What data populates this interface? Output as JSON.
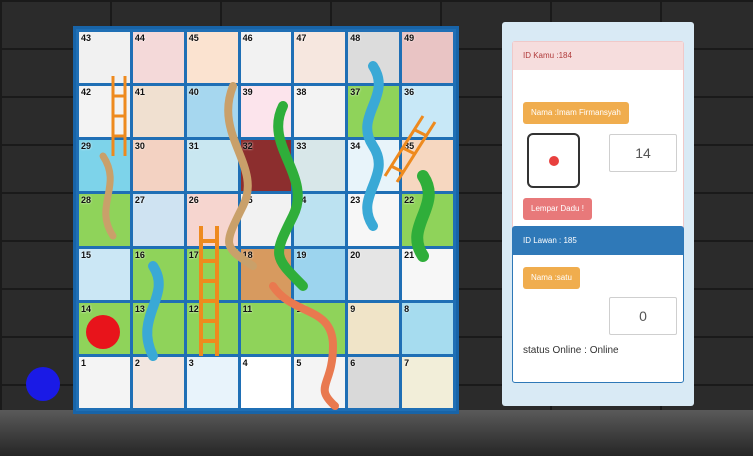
{
  "board": {
    "cells": [
      {
        "n": "43",
        "bg": "#f1f1f1"
      },
      {
        "n": "44",
        "bg": "#f4d9d9"
      },
      {
        "n": "45",
        "bg": "#fbe3d0"
      },
      {
        "n": "46",
        "bg": "#f2f2f2"
      },
      {
        "n": "47",
        "bg": "#f6e7df"
      },
      {
        "n": "48",
        "bg": "#dcdcdc"
      },
      {
        "n": "49",
        "bg": "#e9c4c4"
      },
      {
        "n": "42",
        "bg": "#f3f3f3"
      },
      {
        "n": "41",
        "bg": "#f0e0d0"
      },
      {
        "n": "40",
        "bg": "#a6d7ef"
      },
      {
        "n": "39",
        "bg": "#fce4ec"
      },
      {
        "n": "38",
        "bg": "#f3f3f3"
      },
      {
        "n": "37",
        "bg": "#8fd35a"
      },
      {
        "n": "36",
        "bg": "#c8e8f7"
      },
      {
        "n": "29",
        "bg": "#7dd3ea"
      },
      {
        "n": "30",
        "bg": "#f3d2c2"
      },
      {
        "n": "31",
        "bg": "#c9e7f1"
      },
      {
        "n": "32",
        "bg": "#8c2e2e"
      },
      {
        "n": "33",
        "bg": "#d8e7e9"
      },
      {
        "n": "34",
        "bg": "#e8f4fa"
      },
      {
        "n": "35",
        "bg": "#f6d7c0"
      },
      {
        "n": "28",
        "bg": "#8fd35a"
      },
      {
        "n": "27",
        "bg": "#cfe3f2"
      },
      {
        "n": "26",
        "bg": "#f6d5cf"
      },
      {
        "n": "25",
        "bg": "#f2f2f2"
      },
      {
        "n": "24",
        "bg": "#bce2f1"
      },
      {
        "n": "23",
        "bg": "#f7f7f7"
      },
      {
        "n": "22",
        "bg": "#8fd35a"
      },
      {
        "n": "15",
        "bg": "#cbe7f5"
      },
      {
        "n": "16",
        "bg": "#8fd35a"
      },
      {
        "n": "17",
        "bg": "#8fd35a"
      },
      {
        "n": "18",
        "bg": "#d79a5f"
      },
      {
        "n": "19",
        "bg": "#9cd4ee"
      },
      {
        "n": "20",
        "bg": "#e5e5e5"
      },
      {
        "n": "21",
        "bg": "#f7f7f7"
      },
      {
        "n": "14",
        "bg": "#8fd35a"
      },
      {
        "n": "13",
        "bg": "#8fd35a"
      },
      {
        "n": "12",
        "bg": "#8fd35a"
      },
      {
        "n": "11",
        "bg": "#8fd35a"
      },
      {
        "n": "10",
        "bg": "#8fd35a"
      },
      {
        "n": "9",
        "bg": "#f0e4c8"
      },
      {
        "n": "8",
        "bg": "#a6dcef"
      },
      {
        "n": "1",
        "bg": "#f4f4f4"
      },
      {
        "n": "2",
        "bg": "#f2e6e0"
      },
      {
        "n": "3",
        "bg": "#e8f3fb"
      },
      {
        "n": "4",
        "bg": "#ffffff"
      },
      {
        "n": "5",
        "bg": "#f4f4f4"
      },
      {
        "n": "6",
        "bg": "#d9d9d9"
      },
      {
        "n": "7",
        "bg": "#f2eed9"
      }
    ],
    "colors": {
      "frame": "#1f6fb5",
      "snake_blue": "#3aa9d6",
      "snake_green": "#2fae3a",
      "snake_tan": "#c9a06a",
      "snake_orange": "#e9794f",
      "ladder": "#ee8a1e"
    }
  },
  "players": {
    "me_color": "#e8141b",
    "opponent_color": "#1a1ae6"
  },
  "me": {
    "id_label": "ID Kamu :184",
    "name_label": "Nama :Imam Firmansyah",
    "dice_value": "14",
    "roll_label": "Lempar Dadu !"
  },
  "opponent": {
    "id_label": "ID Lawan : 185",
    "name_label": "Nama :satu",
    "dice_value": "0",
    "status_label": "status Online : Online"
  }
}
